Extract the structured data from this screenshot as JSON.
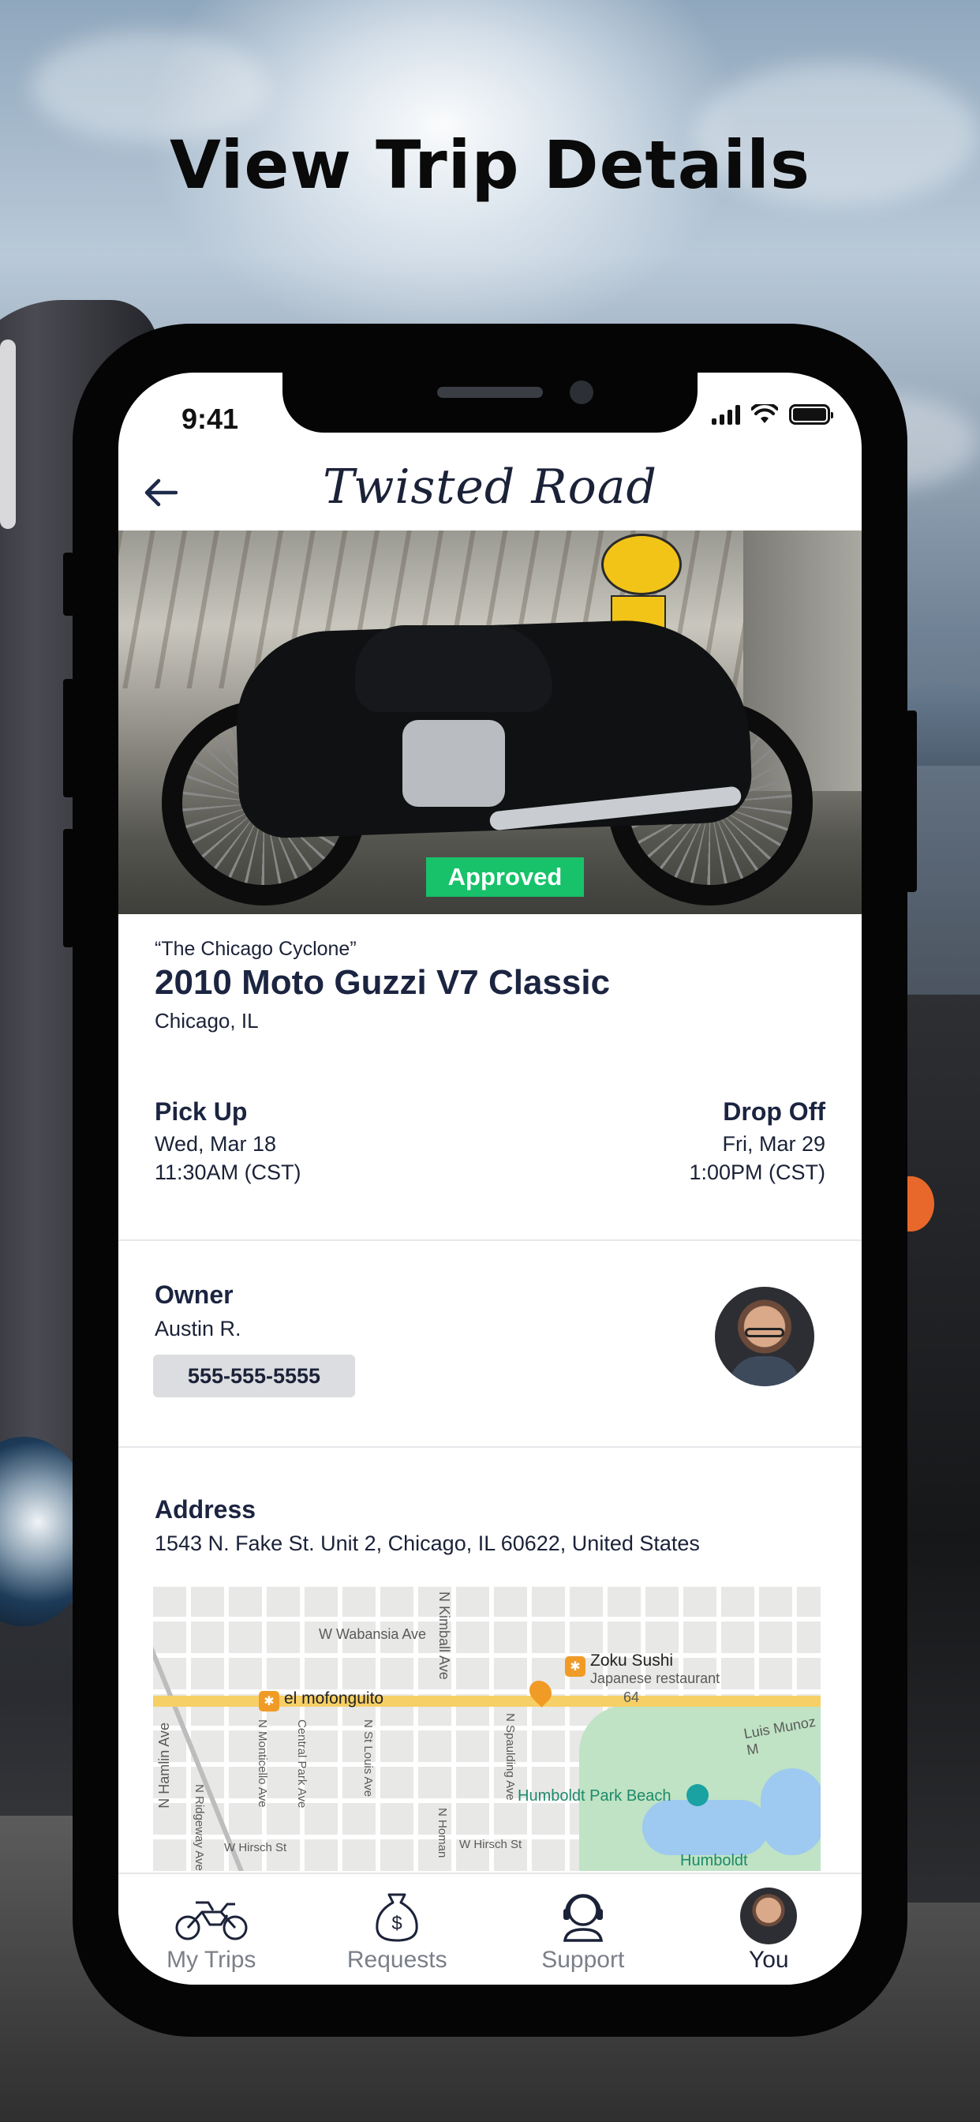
{
  "promo": {
    "headline": "View Trip Details"
  },
  "status_bar": {
    "time": "9:41"
  },
  "header": {
    "logo": "Twisted Road"
  },
  "trip": {
    "status_badge": "Approved",
    "nickname": "“The Chicago Cyclone”",
    "bike_name": "2010 Moto Guzzi V7 Classic",
    "city": "Chicago, IL",
    "pickup": {
      "label": "Pick Up",
      "date": "Wed, Mar 18",
      "time": "11:30AM (CST)"
    },
    "dropoff": {
      "label": "Drop Off",
      "date": "Fri, Mar 29",
      "time": "1:00PM (CST)"
    }
  },
  "owner": {
    "label": "Owner",
    "name": "Austin R.",
    "phone": "555-555-5555"
  },
  "address": {
    "label": "Address",
    "value": "1543 N. Fake St. Unit 2, Chicago, IL 60622, United States",
    "map_labels": {
      "w_wabansia": "W Wabansia Ave",
      "n_kimball": "N Kimball Ave",
      "zoku": "Zoku Sushi",
      "zoku_sub": "Japanese restaurant",
      "mofonguito": "el mofonguito",
      "luis_munoz": "Luis Munoz M",
      "hamlin": "N Hamlin Ave",
      "monticello": "N Monticello Ave",
      "central_park": "Central Park Ave",
      "st_louis": "N St Louis Ave",
      "spaulding": "N Spaulding Ave",
      "humboldt_beach": "Humboldt Park Beach",
      "ridgeway": "N Ridgeway Ave",
      "hirsch_1": "W Hirsch St",
      "homan": "N Homan",
      "hirsch_2": "W Hirsch St",
      "humboldt": "Humboldt",
      "route": "64"
    }
  },
  "tabs": [
    {
      "label": "My Trips",
      "icon": "motorcycle-icon"
    },
    {
      "label": "Requests",
      "icon": "money-bag-icon"
    },
    {
      "label": "Support",
      "icon": "headset-icon"
    },
    {
      "label": "You",
      "icon": "avatar"
    }
  ],
  "colors": {
    "navy_text": "#1b2238",
    "approved_green": "#17c26a",
    "phone_chip_bg": "#dcdde0",
    "tab_inactive": "#7b7f88"
  }
}
